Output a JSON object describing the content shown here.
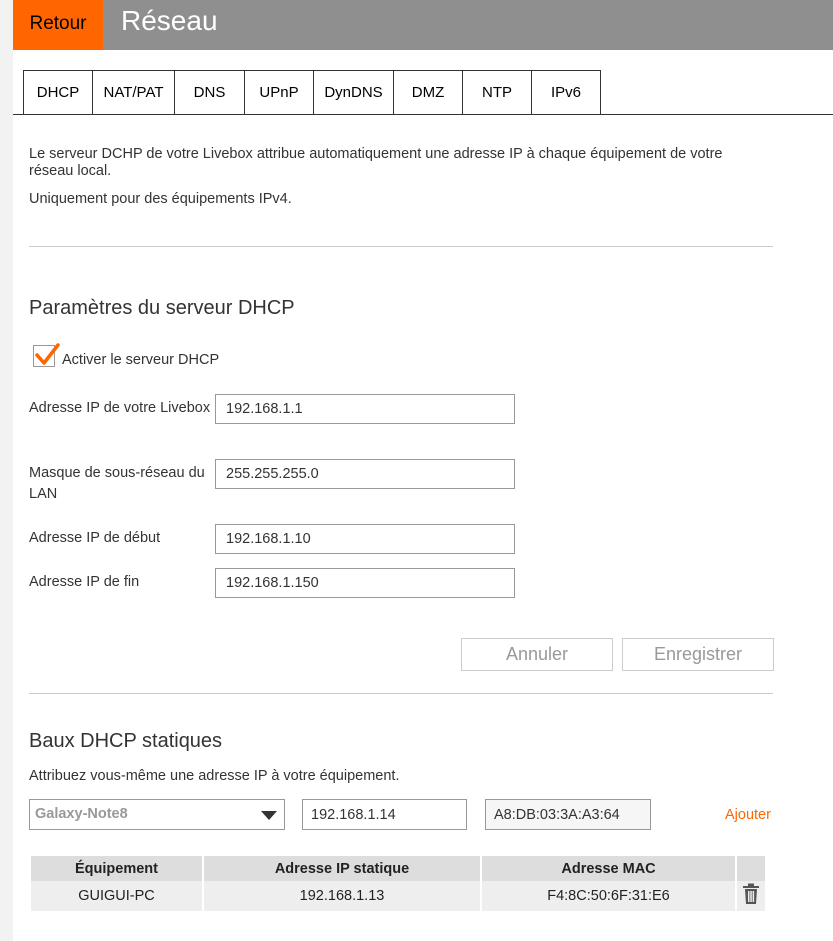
{
  "header": {
    "back_label": "Retour",
    "title": "Réseau"
  },
  "tabs": [
    {
      "label": "DHCP",
      "active": true
    },
    {
      "label": "NAT/PAT"
    },
    {
      "label": "DNS"
    },
    {
      "label": "UPnP"
    },
    {
      "label": "DynDNS"
    },
    {
      "label": "DMZ"
    },
    {
      "label": "NTP"
    },
    {
      "label": "IPv6"
    }
  ],
  "intro": {
    "line1": "Le serveur DCHP de votre Livebox attribue automatiquement une adresse IP à chaque équipement de votre réseau local.",
    "line2": "Uniquement pour des équipements IPv4."
  },
  "dhcp_server": {
    "title": "Paramètres du serveur DHCP",
    "enable_label": "Activer le serveur DHCP",
    "enabled": true,
    "fields": [
      {
        "label": "Adresse IP de votre Livebox",
        "value": "192.168.1.1"
      },
      {
        "label": "Masque de sous-réseau du LAN",
        "value": "255.255.255.0"
      },
      {
        "label": "Adresse IP de début",
        "value": "192.168.1.10"
      },
      {
        "label": "Adresse IP de fin",
        "value": "192.168.1.150"
      }
    ],
    "cancel_label": "Annuler",
    "save_label": "Enregistrer"
  },
  "static_leases": {
    "title": "Baux DHCP statiques",
    "description": "Attribuez vous-même une adresse IP à votre équipement.",
    "device_selected": "Galaxy-Note8",
    "ip_value": "192.168.1.14",
    "mac_value": "A8:DB:03:3A:A3:64",
    "add_label": "Ajouter",
    "table": {
      "headers": [
        "Équipement",
        "Adresse IP statique",
        "Adresse MAC"
      ],
      "rows": [
        {
          "device": "GUIGUI-PC",
          "ip": "192.168.1.13",
          "mac": "F4:8C:50:6F:31:E6"
        }
      ]
    }
  },
  "colors": {
    "accent": "#ff6600",
    "header_bg": "#8f8f8f"
  },
  "icons": {
    "checkbox_check": "check-icon",
    "dropdown": "chevron-down-icon",
    "delete": "trash-icon"
  }
}
